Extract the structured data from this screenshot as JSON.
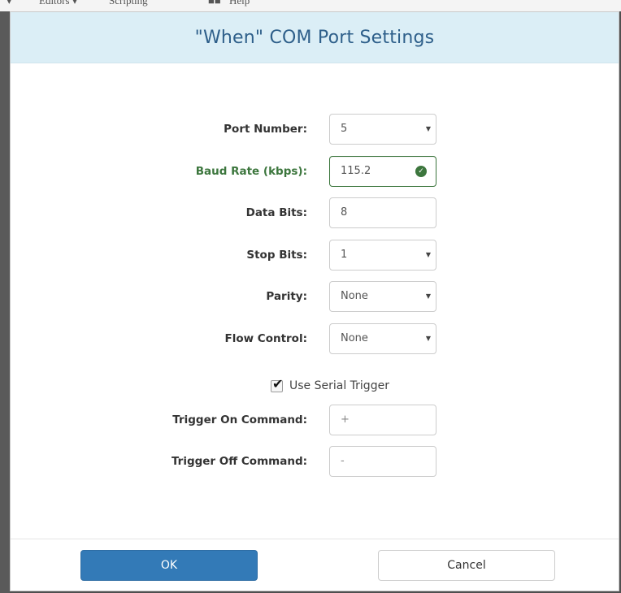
{
  "background_menu": {
    "items": [
      "Editors ▾",
      "Scripting",
      "Help"
    ]
  },
  "dialog": {
    "title": "\"When\" COM Port Settings",
    "fields": {
      "port_number": {
        "label": "Port Number:",
        "value": "5",
        "type": "select"
      },
      "baud_rate": {
        "label": "Baud Rate (kbps):",
        "value": "115.2",
        "type": "input",
        "status": "valid"
      },
      "data_bits": {
        "label": "Data Bits:",
        "value": "8",
        "type": "input"
      },
      "stop_bits": {
        "label": "Stop Bits:",
        "value": "1",
        "type": "select"
      },
      "parity": {
        "label": "Parity:",
        "value": "None",
        "type": "select"
      },
      "flow_control": {
        "label": "Flow Control:",
        "value": "None",
        "type": "select"
      },
      "trigger_on": {
        "label": "Trigger On Command:",
        "value": "+",
        "type": "input"
      },
      "trigger_off": {
        "label": "Trigger Off Command:",
        "value": "-",
        "type": "input"
      }
    },
    "use_serial_trigger": {
      "label": "Use Serial Trigger",
      "checked": true
    },
    "buttons": {
      "ok": "OK",
      "cancel": "Cancel"
    }
  },
  "icons": {
    "caret": "chevron-down-icon",
    "valid": "check-circle-icon",
    "checkbox": "checkmark-icon"
  },
  "colors": {
    "header_bg": "#dbeef6",
    "title": "#2e5f8a",
    "success": "#3c763d",
    "primary": "#337ab7"
  }
}
